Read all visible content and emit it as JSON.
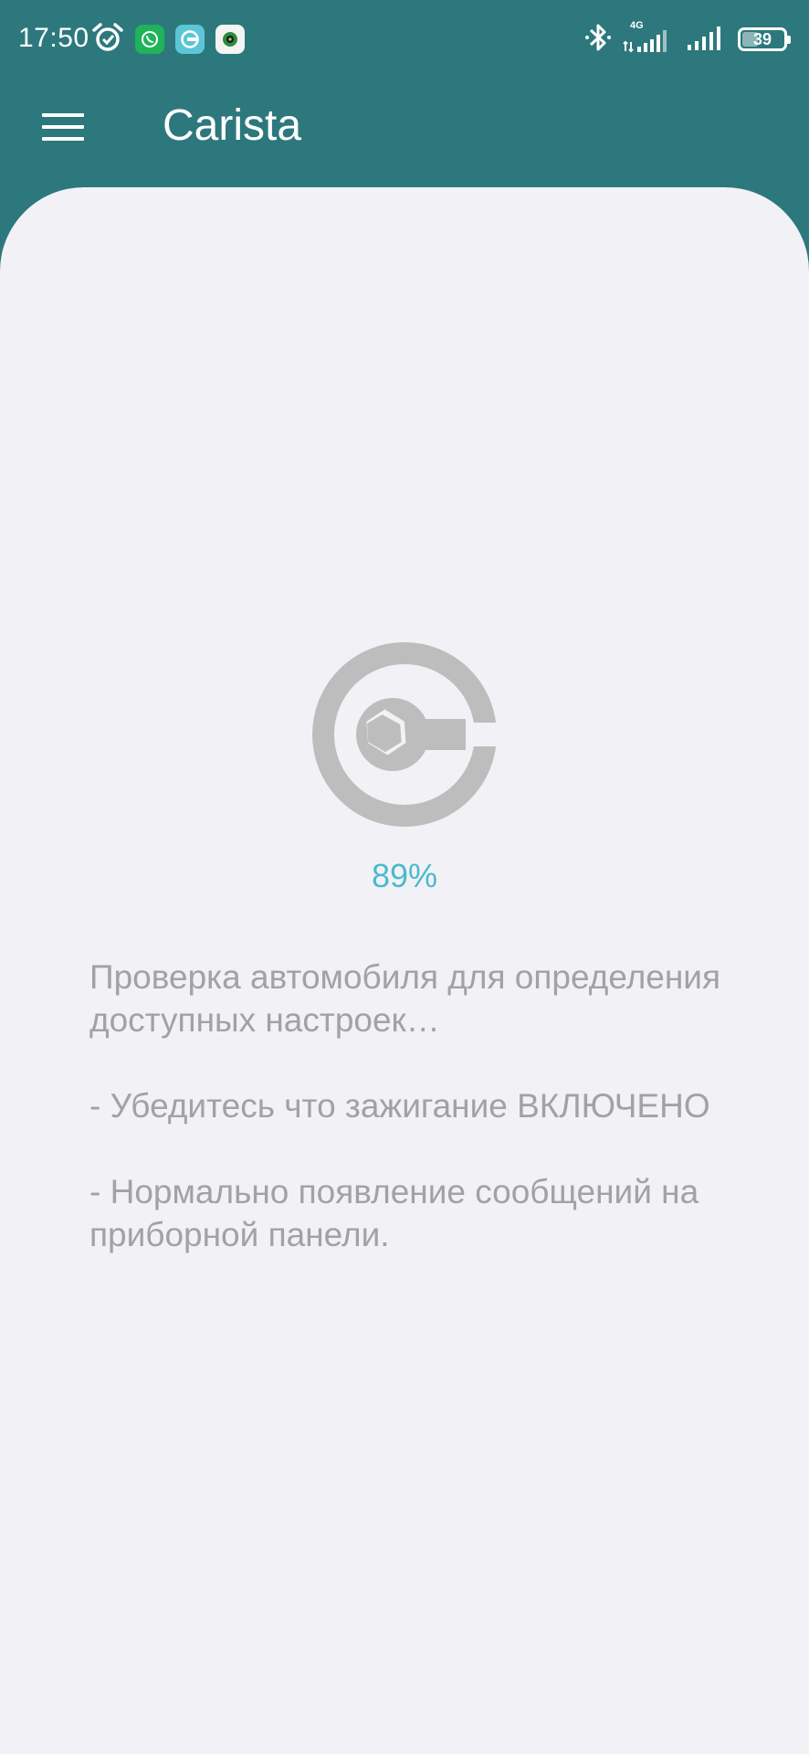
{
  "status_bar": {
    "time": "17:50",
    "left_icons": [
      "alarm-icon",
      "whatsapp-icon",
      "carista-app-icon",
      "camera-app-icon"
    ],
    "right_icons": [
      "bluetooth-icon",
      "signal-4g-icon",
      "signal-icon",
      "battery-icon"
    ],
    "network_label": "4G",
    "battery_level": "39"
  },
  "app_bar": {
    "title": "Carista",
    "menu_icon": "hamburger-menu-icon"
  },
  "loading": {
    "icon": "carista-wrench-logo-icon",
    "progress_text": "89%",
    "progress": 0.89
  },
  "messages": {
    "line1": "Проверка автомобиля для определения доступных настроек…",
    "line2": "- Убедитесь что зажигание ВКЛЮЧЕНО",
    "line3": "- Нормально появление сообщений на приборной панели."
  },
  "colors": {
    "header_bg": "#2d787d",
    "content_bg": "#f2f2f6",
    "accent": "#4bbace",
    "muted_text": "#a2a2a6",
    "logo_gray": "#bdbdbd"
  }
}
